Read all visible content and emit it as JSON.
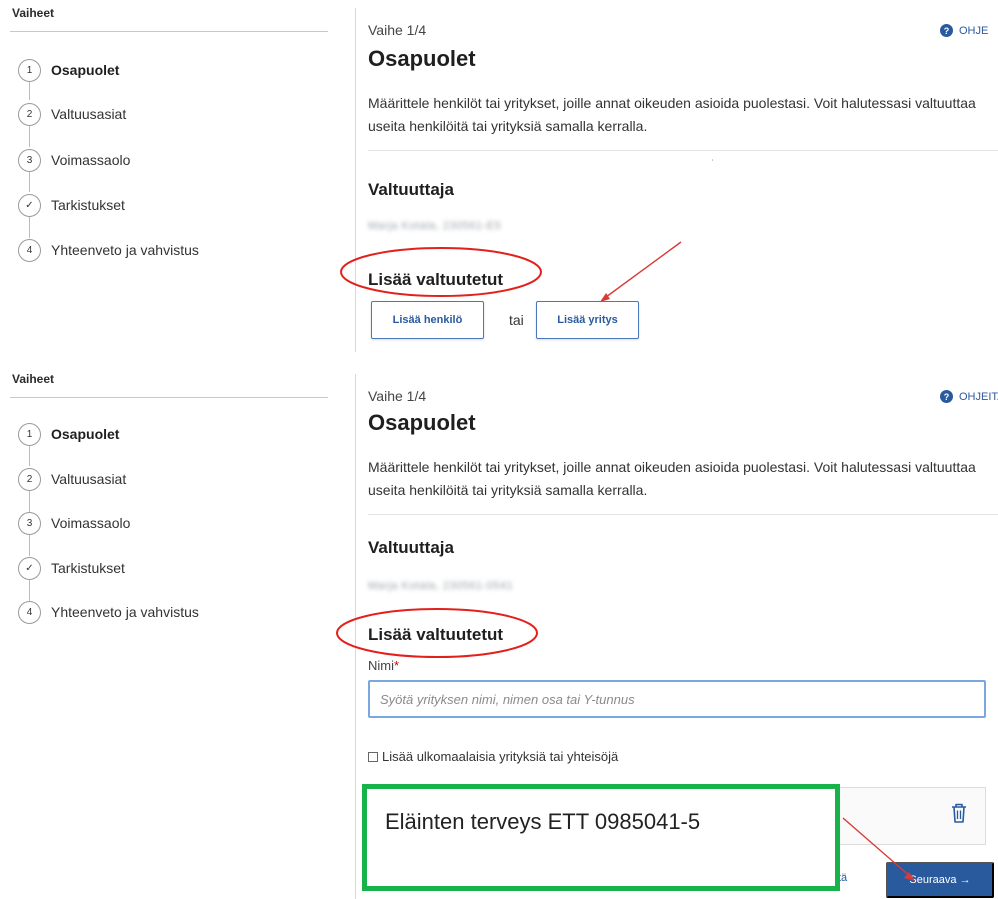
{
  "top": {
    "sidebar": {
      "title": "Vaiheet",
      "steps": [
        {
          "marker": "1",
          "label": "Osapuolet",
          "active": true
        },
        {
          "marker": "2",
          "label": "Valtuusasiat",
          "active": false
        },
        {
          "marker": "3",
          "label": "Voimassaolo",
          "active": false
        },
        {
          "marker": "✓",
          "label": "Tarkistukset",
          "active": false
        },
        {
          "marker": "4",
          "label": "Yhteenveto ja vahvistus",
          "active": false
        }
      ]
    },
    "main": {
      "phase": "Vaihe 1/4",
      "title": "Osapuolet",
      "help_label": "OHJE",
      "intro": "Määrittele henkilöt tai yritykset, joille annat oikeuden asioida puolestasi. Voit halutessasi valtuuttaa useita henkilöitä tai yrityksiä samalla kerralla.",
      "grantor_heading": "Valtuuttaja",
      "grantor_value": "Marja Kotala, 230561-E5",
      "add_heading": "Lisää valtuutetut",
      "add_person_label": "Lisää henkilö",
      "or_label": "tai",
      "add_company_label": "Lisää yritys"
    }
  },
  "bottom": {
    "sidebar": {
      "title": "Vaiheet",
      "steps": [
        {
          "marker": "1",
          "label": "Osapuolet",
          "active": true
        },
        {
          "marker": "2",
          "label": "Valtuusasiat",
          "active": false
        },
        {
          "marker": "3",
          "label": "Voimassaolo",
          "active": false
        },
        {
          "marker": "✓",
          "label": "Tarkistukset",
          "active": false
        },
        {
          "marker": "4",
          "label": "Yhteenveto ja vahvistus",
          "active": false
        }
      ]
    },
    "main": {
      "phase": "Vaihe 1/4",
      "title": "Osapuolet",
      "help_label": "OHJEITA",
      "intro": "Määrittele henkilöt tai yritykset, joille annat oikeuden asioida puolestasi. Voit halutessasi valtuuttaa useita henkilöitä tai yrityksiä samalla kerralla.",
      "grantor_heading": "Valtuuttaja",
      "grantor_value": "Marja Kotala, 230561-0541",
      "add_heading": "Lisää valtuutetut",
      "name_label": "Nimi",
      "name_required": "*",
      "name_placeholder": "Syötä yrityksen nimi, nimen osa tai Y-tunnus",
      "foreign_checkbox_label": "Lisää ulkomaalaisia yrityksiä tai yhteisöjä",
      "next_label": "Seuraava →",
      "peek_link": "tä"
    }
  },
  "annotation": {
    "note_text": "Eläinten terveys ETT 0985041-5",
    "circle_color": "#e3201b",
    "arrow_color": "#d93a36",
    "box_color": "#17b34a"
  }
}
